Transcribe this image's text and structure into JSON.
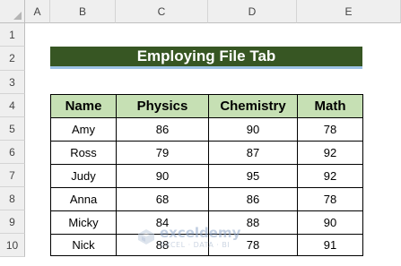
{
  "columns": [
    "A",
    "B",
    "C",
    "D",
    "E"
  ],
  "rows": [
    "1",
    "2",
    "3",
    "4",
    "5",
    "6",
    "7",
    "8",
    "9",
    "10"
  ],
  "title": "Employing File Tab",
  "table": {
    "headers": [
      "Name",
      "Physics",
      "Chemistry",
      "Math"
    ],
    "rows": [
      [
        "Amy",
        "86",
        "90",
        "78"
      ],
      [
        "Ross",
        "79",
        "87",
        "92"
      ],
      [
        "Judy",
        "90",
        "95",
        "92"
      ],
      [
        "Anna",
        "68",
        "86",
        "78"
      ],
      [
        "Micky",
        "84",
        "88",
        "90"
      ],
      [
        "Nick",
        "88",
        "78",
        "91"
      ]
    ]
  },
  "watermark": {
    "name": "exceldemy",
    "tagline": "EXCEL · DATA · BI"
  },
  "colors": {
    "banner": "#375623",
    "banner_underline": "#9dc3e6",
    "table_header": "#c6e0b4",
    "grid_header": "#efefef"
  }
}
